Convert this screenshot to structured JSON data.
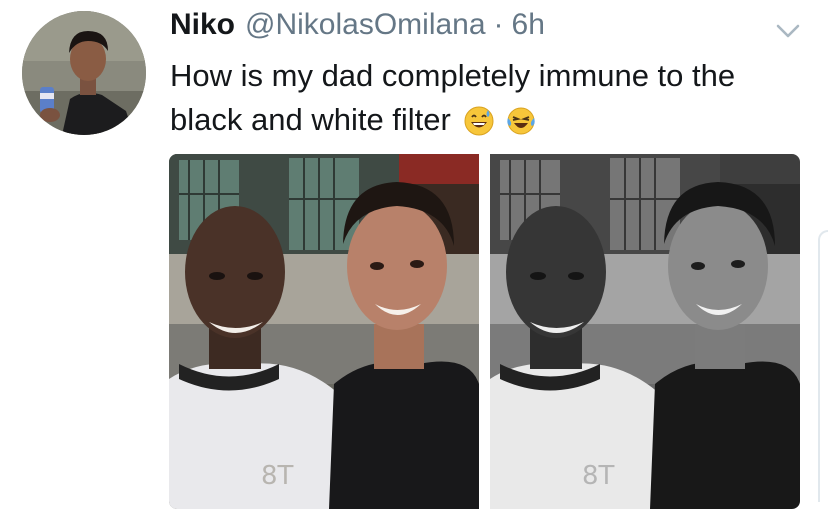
{
  "tweet": {
    "display_name": "Niko",
    "handle": "@NikolasOmilana",
    "separator": "·",
    "timestamp": "6h",
    "text": "How is my dad completely immune to the black and white filter",
    "emojis": [
      "grinning-sweat-emoji",
      "crying-laughing-emoji"
    ]
  },
  "icons": {
    "more": "chevron-down-icon"
  },
  "colors": {
    "text_primary": "#14171a",
    "text_secondary": "#657786",
    "emoji_yellow": "#f7c63a",
    "tear_blue": "#5aa6e8"
  },
  "media": {
    "photo_count": 2,
    "left_filter": "color",
    "right_filter": "grayscale"
  }
}
